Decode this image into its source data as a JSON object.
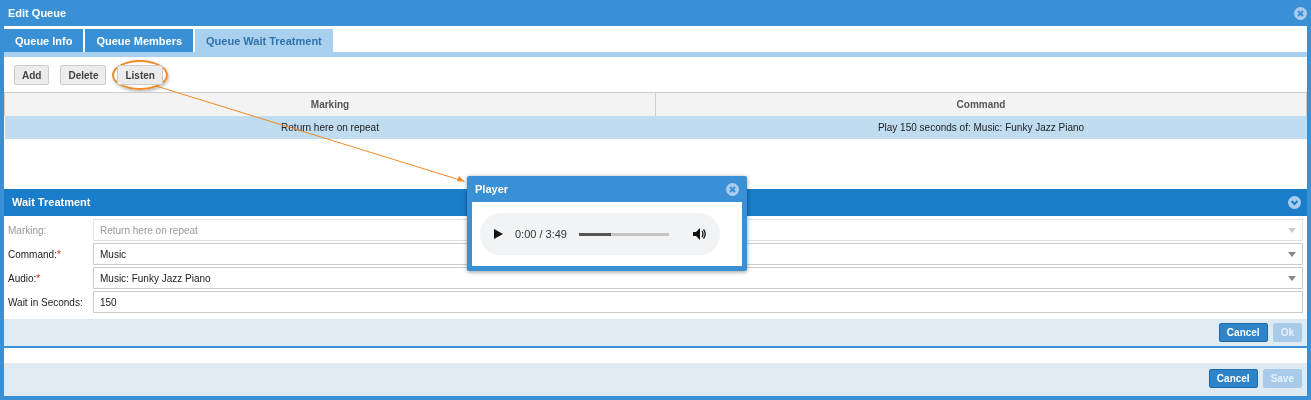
{
  "window": {
    "title": "Edit Queue"
  },
  "tabs": [
    {
      "label": "Queue Info",
      "selected": false
    },
    {
      "label": "Queue Members",
      "selected": false
    },
    {
      "label": "Queue Wait Treatment",
      "selected": true
    }
  ],
  "toolbar": {
    "buttons": [
      {
        "label": "Add",
        "highlighted": false
      },
      {
        "label": "Delete",
        "highlighted": false
      },
      {
        "label": "Listen",
        "highlighted": true
      }
    ]
  },
  "table": {
    "columns": [
      "Marking",
      "Command"
    ],
    "rows": [
      {
        "cells": [
          "Return here on repeat",
          "Play 150 seconds of: Music: Funky Jazz Piano"
        ],
        "selected": true
      }
    ]
  },
  "wait_treatment": {
    "title": "Wait Treatment",
    "fields": [
      {
        "label": "Marking:",
        "kind": "dropdown",
        "value": "Return here on repeat",
        "required": false,
        "disabled": true
      },
      {
        "label": "Command:",
        "kind": "dropdown",
        "value": "Music",
        "required": true,
        "disabled": false
      },
      {
        "label": "Audio:",
        "kind": "dropdown",
        "value": "Music: Funky Jazz Piano",
        "required": true,
        "disabled": false
      },
      {
        "label": "Wait in Seconds:",
        "kind": "text",
        "value": "150",
        "required": false,
        "disabled": false
      }
    ],
    "required_mark": "*",
    "buttons": [
      {
        "label": "Cancel",
        "disabled": false
      },
      {
        "label": "Ok",
        "disabled": true
      }
    ]
  },
  "footer": {
    "buttons": [
      {
        "label": "Cancel",
        "disabled": false
      },
      {
        "label": "Save",
        "disabled": true
      }
    ]
  },
  "player": {
    "title": "Player",
    "time": "0:00 / 3:49",
    "level": 0.35
  }
}
